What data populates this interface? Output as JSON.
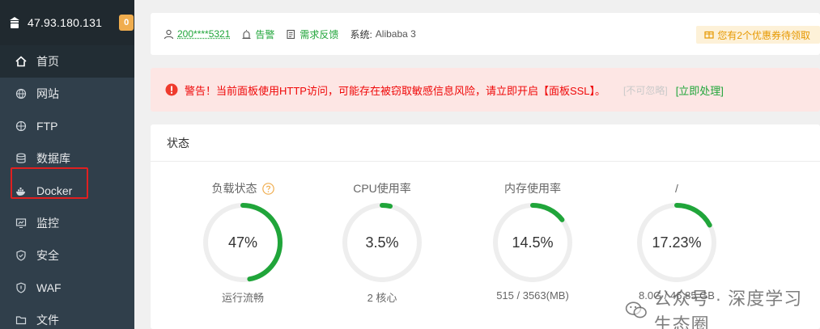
{
  "server": {
    "ip": "47.93.180.131",
    "badge": "0"
  },
  "nav": [
    {
      "label": "首页",
      "icon": "home-icon"
    },
    {
      "label": "网站",
      "icon": "globe-icon"
    },
    {
      "label": "FTP",
      "icon": "ftp-icon"
    },
    {
      "label": "数据库",
      "icon": "database-icon"
    },
    {
      "label": "Docker",
      "icon": "docker-icon"
    },
    {
      "label": "监控",
      "icon": "monitor-icon"
    },
    {
      "label": "安全",
      "icon": "shield-icon"
    },
    {
      "label": "WAF",
      "icon": "waf-shield-icon"
    },
    {
      "label": "文件",
      "icon": "folder-icon"
    }
  ],
  "topbar": {
    "user": "200****5321",
    "alarm": "告警",
    "feedback": "需求反馈",
    "system_label": "系统:",
    "system_value": "Alibaba 3",
    "coupon": "您有2个优惠券待领取"
  },
  "warning": {
    "text": "警告！当前面板使用HTTP访问，可能存在被窃取敏感信息风险，请立即开启【面板SSL】。",
    "ignore": "[不可忽略]",
    "handle": "[立即处理]"
  },
  "status": {
    "title": "状态",
    "gauges": [
      {
        "title": "负载状态",
        "value": "47%",
        "fraction": 0.47,
        "sub": "运行流畅",
        "help": true
      },
      {
        "title": "CPU使用率",
        "value": "3.5%",
        "fraction": 0.035,
        "sub": "2 核心",
        "help": false
      },
      {
        "title": "内存使用率",
        "value": "14.5%",
        "fraction": 0.145,
        "sub": "515 / 3563(MB)",
        "help": false
      },
      {
        "title": "/",
        "value": "17.23%",
        "fraction": 0.1723,
        "sub": "8.0G / 46.85 GB",
        "help": false
      }
    ]
  },
  "watermark": "公众号 · 深度学习生态圈",
  "colors": {
    "sidebar": "#303f4b",
    "accent": "#20a53a",
    "warning": "#ef0808",
    "ring": "#20a53a",
    "track": "#eeeeee"
  }
}
